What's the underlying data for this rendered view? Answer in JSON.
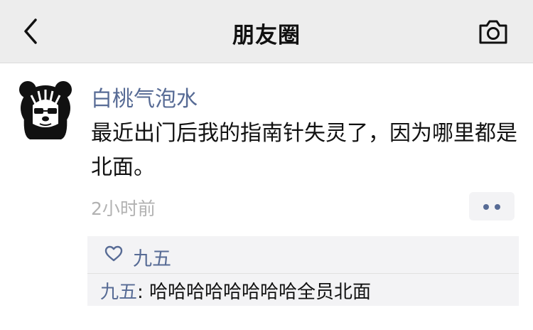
{
  "header": {
    "title": "朋友圈",
    "back_icon": "chevron-left-icon",
    "camera_icon": "camera-icon",
    "background": "#ededed"
  },
  "post": {
    "author": "白桃气泡水",
    "text": "最近出门后我的指南针失灵了，因为哪里都是北面。",
    "time": "2小时前",
    "avatar_icon": "bear-avatar",
    "more_icon": "more-dots-icon",
    "link_color": "#576b95"
  },
  "interactions": {
    "likes": [
      {
        "name": "九五"
      }
    ],
    "comments": [
      {
        "author": "九五",
        "separator": ": ",
        "text": "哈哈哈哈哈哈哈哈全员北面"
      }
    ]
  }
}
